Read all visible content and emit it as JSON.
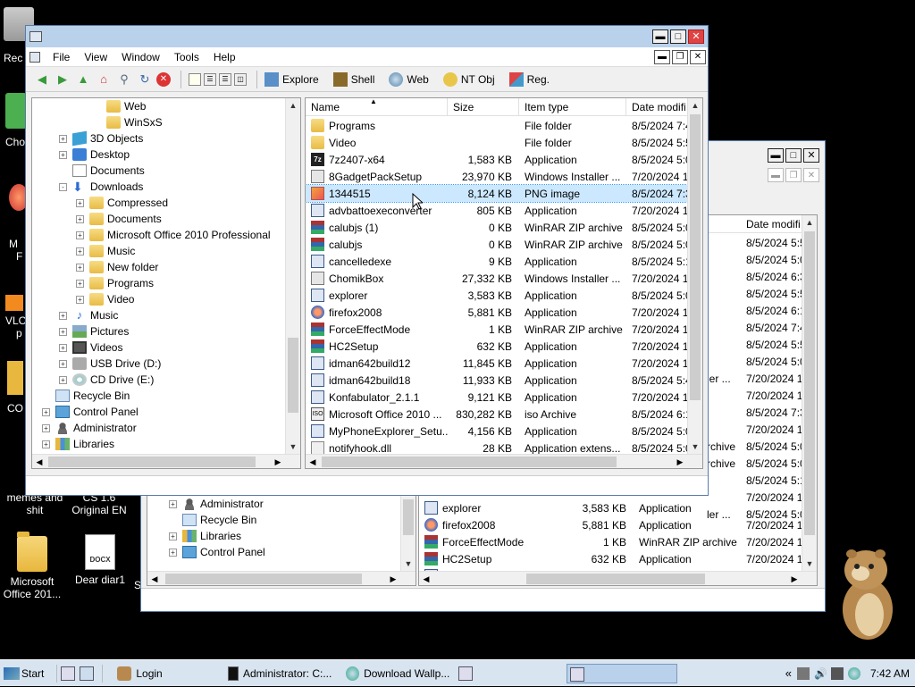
{
  "desktop_icons": [
    {
      "label": "Rec",
      "x": 0
    },
    {
      "label": "Cho",
      "x": 0
    },
    {
      "label": "VLC",
      "x": 0
    },
    {
      "label": "CO",
      "x": 0
    }
  ],
  "desktop_bottom_icons": [
    {
      "label": "memes and shit"
    },
    {
      "label": "CS 1.6 Original EN"
    },
    {
      "label": "Microsoft Office 201..."
    },
    {
      "label": "Dear diar1"
    },
    {
      "label": "DOCX"
    }
  ],
  "front_window": {
    "menu": [
      "File",
      "View",
      "Window",
      "Tools",
      "Help"
    ],
    "toolbar_labels": [
      "Explore",
      "Shell",
      "Web",
      "NT Obj",
      "Reg."
    ],
    "tree": [
      {
        "label": "Web",
        "indent": 4,
        "icon": "folder",
        "exp": ""
      },
      {
        "label": "WinSxS",
        "indent": 4,
        "icon": "folder",
        "exp": ""
      },
      {
        "label": "3D Objects",
        "indent": 2,
        "icon": "3d",
        "exp": "+"
      },
      {
        "label": "Desktop",
        "indent": 2,
        "icon": "blue",
        "exp": "+"
      },
      {
        "label": "Documents",
        "indent": 2,
        "icon": "doc",
        "exp": ""
      },
      {
        "label": "Downloads",
        "indent": 2,
        "icon": "dl",
        "exp": "-"
      },
      {
        "label": "Compressed",
        "indent": 3,
        "icon": "folder",
        "exp": "+"
      },
      {
        "label": "Documents",
        "indent": 3,
        "icon": "folder",
        "exp": "+"
      },
      {
        "label": "Microsoft Office 2010 Professional",
        "indent": 3,
        "icon": "folder",
        "exp": "+"
      },
      {
        "label": "Music",
        "indent": 3,
        "icon": "folder",
        "exp": "+"
      },
      {
        "label": "New folder",
        "indent": 3,
        "icon": "folder",
        "exp": "+"
      },
      {
        "label": "Programs",
        "indent": 3,
        "icon": "folder",
        "exp": "+"
      },
      {
        "label": "Video",
        "indent": 3,
        "icon": "folder",
        "exp": "+"
      },
      {
        "label": "Music",
        "indent": 2,
        "icon": "music",
        "exp": "+"
      },
      {
        "label": "Pictures",
        "indent": 2,
        "icon": "pics",
        "exp": "+"
      },
      {
        "label": "Videos",
        "indent": 2,
        "icon": "vids",
        "exp": "+"
      },
      {
        "label": "USB Drive (D:)",
        "indent": 2,
        "icon": "drive",
        "exp": "+"
      },
      {
        "label": "CD Drive (E:)",
        "indent": 2,
        "icon": "cd",
        "exp": "+"
      },
      {
        "label": "Recycle Bin",
        "indent": 1,
        "icon": "recycle",
        "exp": ""
      },
      {
        "label": "Control Panel",
        "indent": 1,
        "icon": "cpl",
        "exp": "+"
      },
      {
        "label": "Administrator",
        "indent": 1,
        "icon": "user",
        "exp": "+"
      },
      {
        "label": "Libraries",
        "indent": 1,
        "icon": "libs",
        "exp": "+"
      }
    ],
    "columns": [
      "Name",
      "Size",
      "Item type",
      "Date modifi"
    ],
    "files": [
      {
        "name": "Programs",
        "size": "",
        "type": "File folder",
        "date": "8/5/2024 7:4",
        "icon": "folder"
      },
      {
        "name": "Video",
        "size": "",
        "type": "File folder",
        "date": "8/5/2024 5:5",
        "icon": "folder"
      },
      {
        "name": "7z2407-x64",
        "size": "1,583 KB",
        "type": "Application",
        "date": "8/5/2024 5:0",
        "icon": "7z"
      },
      {
        "name": "8GadgetPackSetup",
        "size": "23,970 KB",
        "type": "Windows Installer ...",
        "date": "7/20/2024 1",
        "icon": "msi"
      },
      {
        "name": "1344515",
        "size": "8,124 KB",
        "type": "PNG image",
        "date": "8/5/2024 7:3",
        "icon": "png",
        "selected": true
      },
      {
        "name": "advbattoexeconverter",
        "size": "805 KB",
        "type": "Application",
        "date": "7/20/2024 1",
        "icon": "app"
      },
      {
        "name": "calubjs (1)",
        "size": "0 KB",
        "type": "WinRAR ZIP archive",
        "date": "8/5/2024 5:0",
        "icon": "rar"
      },
      {
        "name": "calubjs",
        "size": "0 KB",
        "type": "WinRAR ZIP archive",
        "date": "8/5/2024 5:0",
        "icon": "rar"
      },
      {
        "name": "cancelledexe",
        "size": "9 KB",
        "type": "Application",
        "date": "8/5/2024 5:1",
        "icon": "app"
      },
      {
        "name": "ChomikBox",
        "size": "27,332 KB",
        "type": "Windows Installer ...",
        "date": "7/20/2024 1",
        "icon": "msi"
      },
      {
        "name": "explorer",
        "size": "3,583 KB",
        "type": "Application",
        "date": "8/5/2024 5:0",
        "icon": "app"
      },
      {
        "name": "firefox2008",
        "size": "5,881 KB",
        "type": "Application",
        "date": "7/20/2024 1",
        "icon": "fx"
      },
      {
        "name": "ForceEffectMode",
        "size": "1 KB",
        "type": "WinRAR ZIP archive",
        "date": "7/20/2024 1",
        "icon": "rar"
      },
      {
        "name": "HC2Setup",
        "size": "632 KB",
        "type": "Application",
        "date": "7/20/2024 1",
        "icon": "rar"
      },
      {
        "name": "idman642build12",
        "size": "11,845 KB",
        "type": "Application",
        "date": "7/20/2024 1",
        "icon": "app"
      },
      {
        "name": "idman642build18",
        "size": "11,933 KB",
        "type": "Application",
        "date": "8/5/2024 5:4",
        "icon": "app"
      },
      {
        "name": "Konfabulator_2.1.1",
        "size": "9,121 KB",
        "type": "Application",
        "date": "7/20/2024 1",
        "icon": "app"
      },
      {
        "name": "Microsoft Office 2010 ...",
        "size": "830,282 KB",
        "type": "iso Archive",
        "date": "8/5/2024 6:1",
        "icon": "iso"
      },
      {
        "name": "MyPhoneExplorer_Setu...",
        "size": "4,156 KB",
        "type": "Application",
        "date": "8/5/2024 5:0",
        "icon": "app"
      },
      {
        "name": "notifyhook.dll",
        "size": "28 KB",
        "type": "Application extens...",
        "date": "8/5/2024 5:0",
        "icon": "dll"
      }
    ]
  },
  "back_window": {
    "column_date": "Date modifi",
    "dates": [
      "8/5/2024 5:5",
      "8/5/2024 5:0",
      "8/5/2024 6:3",
      "8/5/2024 5:5",
      "8/5/2024 6:1",
      "8/5/2024 7:4",
      "8/5/2024 5:5",
      "8/5/2024 5:0",
      "7/20/2024 1",
      "7/20/2024 1",
      "8/5/2024 7:3",
      "7/20/2024 1",
      "8/5/2024 5:0",
      "8/5/2024 5:0",
      "8/5/2024 5:1",
      "7/20/2024 1",
      "8/5/2024 5:0"
    ],
    "partial_left": [
      {
        "text": "ler ...",
        "row": 8
      },
      {
        "text": "rchive",
        "row": 12
      },
      {
        "text": "rchive",
        "row": 13
      },
      {
        "text": "ler ...",
        "row": 16
      }
    ],
    "tree": [
      {
        "label": "CD Drive (E:)",
        "exp": "+"
      },
      {
        "label": "Administrator",
        "exp": "+"
      },
      {
        "label": "Recycle Bin",
        "exp": ""
      },
      {
        "label": "Libraries",
        "exp": "+"
      },
      {
        "label": "Control Panel",
        "exp": "+"
      }
    ],
    "files": [
      {
        "name": "explorer",
        "size": "3,583 KB",
        "type": "Application",
        "date": "",
        "icon": "app"
      },
      {
        "name": "firefox2008",
        "size": "5,881 KB",
        "type": "Application",
        "date": "7/20/2024 1",
        "icon": "fx"
      },
      {
        "name": "ForceEffectMode",
        "size": "1 KB",
        "type": "WinRAR ZIP archive",
        "date": "7/20/2024 1",
        "icon": "rar"
      },
      {
        "name": "HC2Setup",
        "size": "632 KB",
        "type": "Application",
        "date": "7/20/2024 1",
        "icon": "rar"
      },
      {
        "name": "idman642build12",
        "size": "11,845 KB",
        "type": "Application",
        "date": "7/20/2024 1",
        "icon": "app"
      }
    ]
  },
  "taskbar": {
    "start": "Start",
    "items": [
      "Login",
      "Administrator: C:...",
      "Download Wallp..."
    ],
    "clock": "7:42 AM"
  }
}
